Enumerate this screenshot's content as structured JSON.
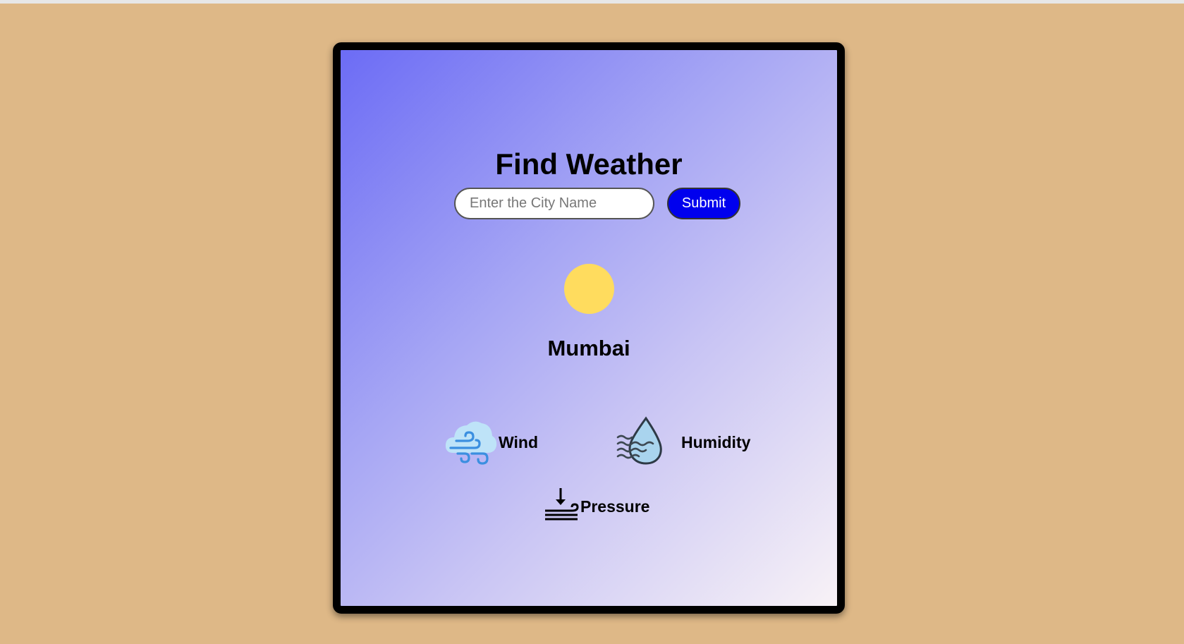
{
  "app": {
    "title": "Find Weather"
  },
  "search": {
    "placeholder": "Enter the City Name",
    "value": "",
    "submit_label": "Submit"
  },
  "weather": {
    "condition_icon": "sun-icon",
    "city": "Mumbai"
  },
  "stats": {
    "wind": {
      "label": "Wind",
      "icon": "wind-cloud-icon"
    },
    "humidity": {
      "label": "Humidity",
      "icon": "humidity-drop-icon"
    },
    "pressure": {
      "label": "Pressure",
      "icon": "pressure-icon"
    }
  },
  "colors": {
    "page_background": "#deb887",
    "submit_button": "#0000ee",
    "sun": "#ffdc5e",
    "card_gradient": [
      "#6c6cf5",
      "#a5a5f4",
      "#c8c4f4",
      "#f8f2f6"
    ]
  }
}
